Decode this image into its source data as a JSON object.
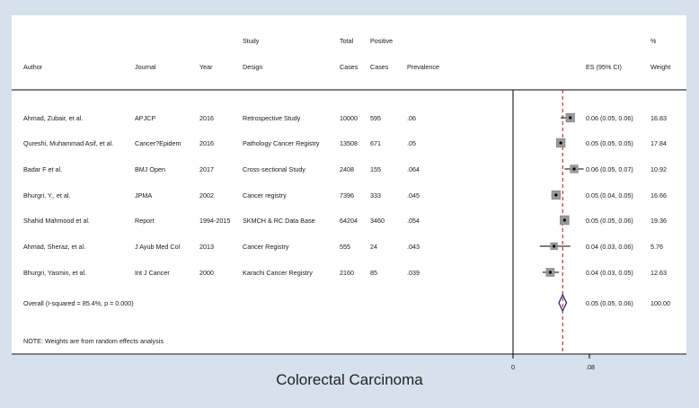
{
  "chart_data": {
    "type": "forest",
    "title": "Colorectal Carcinoma",
    "headers": {
      "author": "Author",
      "journal": "Journal",
      "year": "Year",
      "design": [
        "Study",
        "Design"
      ],
      "total": [
        "Total",
        "Cases"
      ],
      "positive": [
        "Positive",
        "Cases"
      ],
      "prevalence": "Prevalence",
      "es": "ES (95% CI)",
      "weight": [
        "%",
        "Weight"
      ]
    },
    "studies": [
      {
        "author": "Ahmad, Zubair, et al.",
        "journal": "APJCP",
        "year": "2016",
        "design": "Retrospective Study",
        "total": "10000",
        "positive": "595",
        "prevalence": ".06",
        "es": 0.06,
        "lo": 0.05,
        "hi": 0.06,
        "es_label": "0.06 (0.05, 0.06)",
        "weight": "16.83"
      },
      {
        "author": "Qureshi, Muhammad Asif, et al.",
        "journal": "Cancer?Epidem",
        "year": "2016",
        "design": "Pathology Cancer Registry",
        "total": "13508",
        "positive": "671",
        "prevalence": ".05",
        "es": 0.05,
        "lo": 0.05,
        "hi": 0.05,
        "es_label": "0.05 (0.05, 0.05)",
        "weight": "17.84"
      },
      {
        "author": "Badar F et al.",
        "journal": "BMJ Open",
        "year": "2017",
        "design": "Cross-sectional Study",
        "total": "2408",
        "positive": "155",
        "prevalence": ".064",
        "es": 0.064,
        "lo": 0.054,
        "hi": 0.074,
        "es_label": "0.06 (0.05, 0.07)",
        "weight": "10.92"
      },
      {
        "author": "Bhurgri, Y., et al.",
        "journal": "JPMA",
        "year": "2002",
        "design": "Cancer registry",
        "total": "7396",
        "positive": "333",
        "prevalence": ".045",
        "es": 0.045,
        "lo": 0.04,
        "hi": 0.05,
        "es_label": "0.05 (0.04, 0.05)",
        "weight": "16.66"
      },
      {
        "author": "Shahid Mahmood et al.",
        "journal": "Report",
        "year": "1994-2015",
        "design": "SKMCH & RC Data Base",
        "total": "64204",
        "positive": "3460",
        "prevalence": ".054",
        "es": 0.054,
        "lo": 0.052,
        "hi": 0.056,
        "es_label": "0.05 (0.05, 0.06)",
        "weight": "19.36"
      },
      {
        "author": "Ahmad, Sheraz, et al.",
        "journal": "J Ayub Med Col",
        "year": "2013",
        "design": "Cancer Registry",
        "total": "555",
        "positive": "24",
        "prevalence": ".043",
        "es": 0.043,
        "lo": 0.028,
        "hi": 0.06,
        "es_label": "0.04 (0.03, 0.06)",
        "weight": "5.76"
      },
      {
        "author": "Bhurgri, Yasmin, et al.",
        "journal": "Int J Cancer",
        "year": "2000",
        "design": "Karachi Cancer Registry",
        "total": "2160",
        "positive": "85",
        "prevalence": ".039",
        "es": 0.039,
        "lo": 0.031,
        "hi": 0.048,
        "es_label": "0.04 (0.03, 0.05)",
        "weight": "12.63"
      }
    ],
    "overall": {
      "label": "Overall  (I-squared = 85.4%, p = 0.000)",
      "es": 0.052,
      "lo": 0.048,
      "hi": 0.056,
      "es_label": "0.05 (0.05, 0.06)",
      "weight": "100.00"
    },
    "note": "NOTE: Weights are from random effects analysis",
    "xaxis": {
      "ticks": [
        0,
        0.08
      ],
      "tick_labels": [
        "0",
        ".08"
      ],
      "range": [
        0,
        0.1
      ]
    },
    "colors": {
      "background": "#d5e1ec",
      "panel": "#ffffff",
      "ci_line": "#000000",
      "point": "#000000",
      "box": "#9a9a9a",
      "diamond": "#1c1c6e",
      "overall_line": "#b01515"
    }
  }
}
